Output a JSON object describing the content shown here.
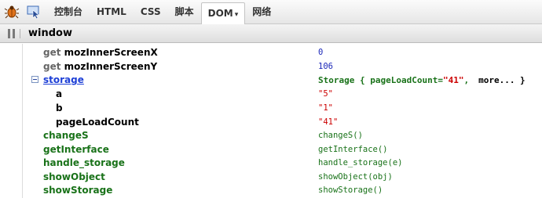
{
  "toolbar": {
    "tabs": [
      {
        "label": "控制台"
      },
      {
        "label": "HTML"
      },
      {
        "label": "CSS"
      },
      {
        "label": "脚本"
      },
      {
        "label": "DOM",
        "active": true,
        "caret": "▾"
      },
      {
        "label": "网络"
      }
    ]
  },
  "pathbar": {
    "label": "window"
  },
  "rows": [
    {
      "prefix": "get",
      "name": "mozInnerScreenX",
      "value": "0",
      "kind": "num"
    },
    {
      "prefix": "get",
      "name": "mozInnerScreenY",
      "value": "106",
      "kind": "num"
    },
    {
      "name": "storage",
      "kind": "object",
      "expanded": true,
      "value_prefix": "Storage {  pageLoadCount=",
      "value_str": "\"41\"",
      "value_suffix": ",",
      "more": "more... }"
    },
    {
      "name": "a",
      "value": "\"5\"",
      "kind": "str",
      "child": true
    },
    {
      "name": "b",
      "value": "\"1\"",
      "kind": "str",
      "child": true
    },
    {
      "name": "pageLoadCount",
      "value": "\"41\"",
      "kind": "str",
      "child": true
    },
    {
      "name": "changeS",
      "value": "changeS()",
      "kind": "func"
    },
    {
      "name": "getInterface",
      "value": "getInterface()",
      "kind": "func"
    },
    {
      "name": "handle_storage",
      "value": "handle_storage(e)",
      "kind": "func"
    },
    {
      "name": "showObject",
      "value": "showObject(obj)",
      "kind": "func"
    },
    {
      "name": "showStorage",
      "value": "showStorage()",
      "kind": "func"
    }
  ],
  "colors": {
    "link": "#1d3fd6",
    "func": "#197219",
    "string": "#cc0000",
    "number": "#1c28b8"
  },
  "icons": [
    "firebug-bug-icon",
    "inspect-pointer-icon",
    "pane-grip-icon",
    "collapse-toggle-icon"
  ]
}
